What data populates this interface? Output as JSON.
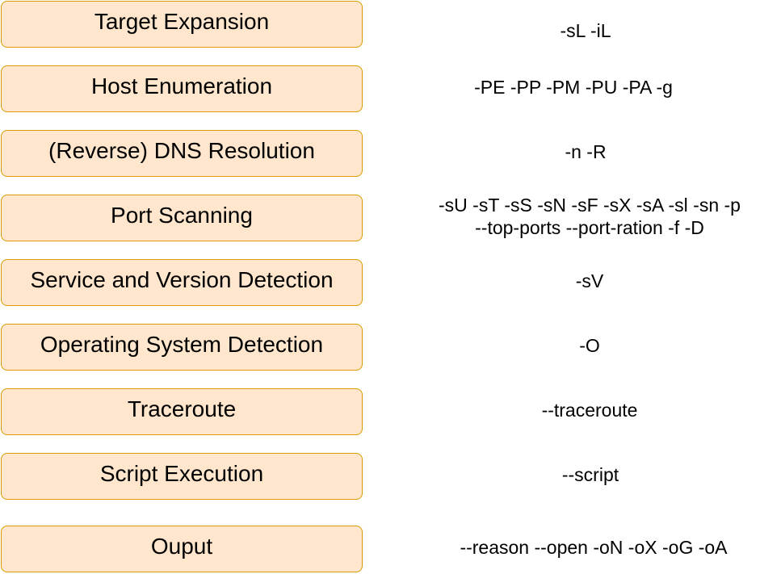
{
  "stages": [
    {
      "label": "Target Expansion",
      "options": [
        "-sL -iL"
      ]
    },
    {
      "label": "Host Enumeration",
      "options": [
        "-PE -PP -PM -PU -PA -g"
      ]
    },
    {
      "label": "(Reverse) DNS Resolution",
      "options": [
        "-n -R"
      ]
    },
    {
      "label": "Port Scanning",
      "options": [
        "-sU -sT -sS -sN -sF -sX -sA -sl -sn -p",
        "--top-ports --port-ration -f -D"
      ]
    },
    {
      "label": "Service and Version Detection",
      "options": [
        "-sV"
      ]
    },
    {
      "label": "Operating System Detection",
      "options": [
        "-O"
      ]
    },
    {
      "label": "Traceroute",
      "options": [
        "--traceroute"
      ]
    },
    {
      "label": "Script Execution",
      "options": [
        "--script"
      ]
    },
    {
      "label": "Ouput",
      "options": [
        "--reason --open -oN -oX -oG -oA"
      ]
    }
  ],
  "colors": {
    "box_fill": "#FFE6CC",
    "box_border": "#D79B00",
    "text": "#000000"
  }
}
